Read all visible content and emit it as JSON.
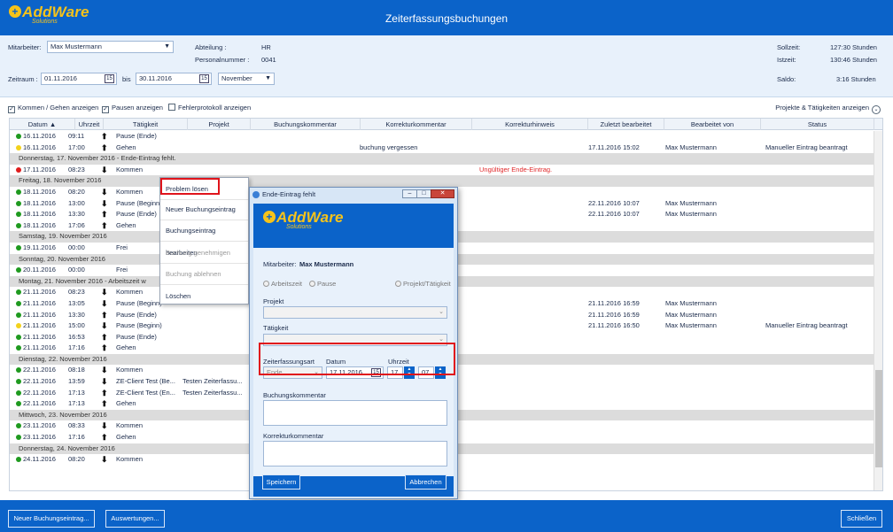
{
  "app": {
    "logo_main": "AddWare",
    "logo_sub": "Solutions",
    "title": "Zeiterfassungsbuchungen"
  },
  "filters": {
    "mitarbeiter_label": "Mitarbeiter:",
    "mitarbeiter_value": "Max Mustermann",
    "abteilung_label": "Abteilung :",
    "abteilung_value": "HR",
    "personalnummer_label": "Personalnummer :",
    "personalnummer_value": "0041",
    "zeitraum_label": "Zeitraum :",
    "from_date": "01.11.2016",
    "bis_label": "bis",
    "to_date": "30.11.2016",
    "month_value": "November",
    "sollzeit_label": "Sollzeit:",
    "sollzeit_value": "127:30 Stunden",
    "istzeit_label": "Istzeit:",
    "istzeit_value": "130:46 Stunden",
    "saldo_label": "Saldo:",
    "saldo_value": "3:16 Stunden"
  },
  "options": {
    "kommen_gehen": "Kommen / Gehen anzeigen",
    "pausen": "Pausen anzeigen",
    "fehlerprotokoll": "Fehlerprotokoll anzeigen",
    "projekte_toggle": "Projekte & Tätigkeiten anzeigen"
  },
  "columns": [
    "Datum",
    "Uhrzeit",
    "Tätigkeit",
    "Projekt",
    "Buchungskommentar",
    "Korrekturkommentar",
    "Korrekturhinweis",
    "Zuletzt bearbeitet",
    "Bearbeitet von",
    "Status"
  ],
  "rows": [
    {
      "type": "r",
      "dot": "g",
      "dir": "up",
      "date": "16.11.2016",
      "time": "09:11",
      "act": "Pause (Ende)",
      "proj": "",
      "kk": "",
      "hint": "",
      "edited": "",
      "by": "",
      "status": ""
    },
    {
      "type": "r",
      "dot": "y",
      "dir": "up",
      "date": "16.11.2016",
      "time": "17:00",
      "act": "Gehen",
      "proj": "",
      "kk": "buchung vergessen",
      "hint": "",
      "edited": "17.11.2016 15:02",
      "by": "Max Mustermann",
      "status": "Manueller Eintrag beantragt"
    },
    {
      "type": "g",
      "label": "Donnerstag, 17. November 2016  - Ende-Eintrag fehlt."
    },
    {
      "type": "r",
      "dot": "r",
      "dir": "down",
      "date": "17.11.2016",
      "time": "08:23",
      "act": "Kommen",
      "proj": "",
      "kk": "",
      "hint": "Ungültiger Ende-Eintrag.",
      "edited": "",
      "by": "",
      "status": ""
    },
    {
      "type": "g",
      "label": "Freitag, 18. November 2016"
    },
    {
      "type": "r",
      "dot": "g",
      "dir": "down",
      "date": "18.11.2016",
      "time": "08:20",
      "act": "Kommen",
      "proj": "",
      "kk": "",
      "hint": "",
      "edited": "",
      "by": "",
      "status": ""
    },
    {
      "type": "r",
      "dot": "g",
      "dir": "down",
      "date": "18.11.2016",
      "time": "13:00",
      "act": "Pause (Beginn)",
      "proj": "",
      "kk": "",
      "hint": "",
      "edited": "22.11.2016 10:07",
      "by": "Max Mustermann",
      "status": ""
    },
    {
      "type": "r",
      "dot": "g",
      "dir": "up",
      "date": "18.11.2016",
      "time": "13:30",
      "act": "Pause (Ende)",
      "proj": "",
      "kk": "",
      "hint": "",
      "edited": "22.11.2016 10:07",
      "by": "Max Mustermann",
      "status": ""
    },
    {
      "type": "r",
      "dot": "g",
      "dir": "up",
      "date": "18.11.2016",
      "time": "17:06",
      "act": "Gehen",
      "proj": "",
      "kk": "",
      "hint": "",
      "edited": "",
      "by": "",
      "status": ""
    },
    {
      "type": "g",
      "label": "Samstag, 19. November 2016"
    },
    {
      "type": "r",
      "dot": "g",
      "dir": "",
      "date": "19.11.2016",
      "time": "00:00",
      "act": "Frei",
      "proj": "",
      "kk": "",
      "hint": "",
      "edited": "",
      "by": "",
      "status": ""
    },
    {
      "type": "g",
      "label": "Sonntag, 20. November 2016"
    },
    {
      "type": "r",
      "dot": "g",
      "dir": "",
      "date": "20.11.2016",
      "time": "00:00",
      "act": "Frei",
      "proj": "",
      "kk": "",
      "hint": "",
      "edited": "",
      "by": "",
      "status": ""
    },
    {
      "type": "g",
      "label": "Montag, 21. November 2016  - Arbeitszeit w"
    },
    {
      "type": "r",
      "dot": "g",
      "dir": "down",
      "date": "21.11.2016",
      "time": "08:23",
      "act": "Kommen",
      "proj": "",
      "kk": "",
      "hint": "",
      "edited": "",
      "by": "",
      "status": ""
    },
    {
      "type": "r",
      "dot": "g",
      "dir": "down",
      "date": "21.11.2016",
      "time": "13:05",
      "act": "Pause (Beginn)",
      "proj": "",
      "kk": "",
      "hint": "",
      "edited": "21.11.2016 16:59",
      "by": "Max Mustermann",
      "status": ""
    },
    {
      "type": "r",
      "dot": "g",
      "dir": "up",
      "date": "21.11.2016",
      "time": "13:30",
      "act": "Pause (Ende)",
      "proj": "",
      "kk": "",
      "hint": "",
      "edited": "21.11.2016 16:59",
      "by": "Max Mustermann",
      "status": ""
    },
    {
      "type": "r",
      "dot": "y",
      "dir": "down",
      "date": "21.11.2016",
      "time": "15:00",
      "act": "Pause (Beginn)",
      "proj": "",
      "kk": "",
      "hint": "",
      "edited": "21.11.2016 16:50",
      "by": "Max Mustermann",
      "status": "Manueller Eintrag beantragt"
    },
    {
      "type": "r",
      "dot": "g",
      "dir": "up",
      "date": "21.11.2016",
      "time": "16:53",
      "act": "Pause (Ende)",
      "proj": "",
      "kk": "",
      "hint": "",
      "edited": "",
      "by": "",
      "status": ""
    },
    {
      "type": "r",
      "dot": "g",
      "dir": "up",
      "date": "21.11.2016",
      "time": "17:16",
      "act": "Gehen",
      "proj": "",
      "kk": "",
      "hint": "",
      "edited": "",
      "by": "",
      "status": ""
    },
    {
      "type": "g",
      "label": "Dienstag, 22. November 2016"
    },
    {
      "type": "r",
      "dot": "g",
      "dir": "down",
      "date": "22.11.2016",
      "time": "08:18",
      "act": "Kommen",
      "proj": "",
      "kk": "",
      "hint": "",
      "edited": "",
      "by": "",
      "status": ""
    },
    {
      "type": "r",
      "dot": "g",
      "dir": "down",
      "date": "22.11.2016",
      "time": "13:59",
      "act": "ZE-Client Test (Be...",
      "proj": "Testen Zeiterfassu...",
      "kk": "",
      "hint": "",
      "edited": "",
      "by": "",
      "status": ""
    },
    {
      "type": "r",
      "dot": "g",
      "dir": "up",
      "date": "22.11.2016",
      "time": "17:13",
      "act": "ZE-Client Test (En...",
      "proj": "Testen Zeiterfassu...",
      "kk": "",
      "hint": "",
      "edited": "",
      "by": "",
      "status": ""
    },
    {
      "type": "r",
      "dot": "g",
      "dir": "up",
      "date": "22.11.2016",
      "time": "17:13",
      "act": "Gehen",
      "proj": "",
      "kk": "",
      "hint": "",
      "edited": "",
      "by": "",
      "status": ""
    },
    {
      "type": "g",
      "label": "Mittwoch, 23. November 2016"
    },
    {
      "type": "r",
      "dot": "g",
      "dir": "down",
      "date": "23.11.2016",
      "time": "08:33",
      "act": "Kommen",
      "proj": "",
      "kk": "",
      "hint": "",
      "edited": "",
      "by": "",
      "status": ""
    },
    {
      "type": "r",
      "dot": "g",
      "dir": "up",
      "date": "23.11.2016",
      "time": "17:16",
      "act": "Gehen",
      "proj": "",
      "kk": "",
      "hint": "",
      "edited": "",
      "by": "",
      "status": ""
    },
    {
      "type": "g",
      "label": "Donnerstag, 24. November 2016"
    },
    {
      "type": "r",
      "dot": "g",
      "dir": "down",
      "date": "24.11.2016",
      "time": "08:20",
      "act": "Kommen",
      "proj": "",
      "kk": "",
      "hint": "",
      "edited": "",
      "by": "",
      "status": ""
    }
  ],
  "context_menu": {
    "problem_loesen": "Problem lösen",
    "neuer_eintrag": "Neuer Buchungseintrag",
    "bearbeiten": "Buchungseintrag bearbeiten",
    "genehmigen": "Buchung genehmigen",
    "ablehnen": "Buchung ablehnen",
    "loeschen": "Löschen"
  },
  "dialog": {
    "title": "Ende-Eintrag fehlt",
    "mitarbeiter_label": "Mitarbeiter:",
    "mitarbeiter_value": "Max Mustermann",
    "radio_arbeitszeit": "Arbeitszeit",
    "radio_pause": "Pause",
    "radio_projekt": "Projekt/Tätigkeit",
    "projekt_label": "Projekt",
    "taetigkeit_label": "Tätigkeit",
    "zeiterfassungsart_label": "Zeiterfassungsart",
    "datum_label": "Datum",
    "uhrzeit_label": "Uhrzeit",
    "art_value": "Ende",
    "datum_value": "17.11.2016",
    "hour_value": "17",
    "minute_value": "07",
    "buchungskommentar_label": "Buchungskommentar",
    "korrekturkommentar_label": "Korrekturkommentar",
    "save_label": "Speichern",
    "cancel_label": "Abbrechen"
  },
  "bottom": {
    "new_entry": "Neuer Buchungseintrag...",
    "reports": "Auswertungen...",
    "close": "Schließen"
  },
  "colors": {
    "brand_blue": "#0b63c9",
    "logo_yellow": "#f6c31a",
    "error_red": "#e0282a"
  }
}
